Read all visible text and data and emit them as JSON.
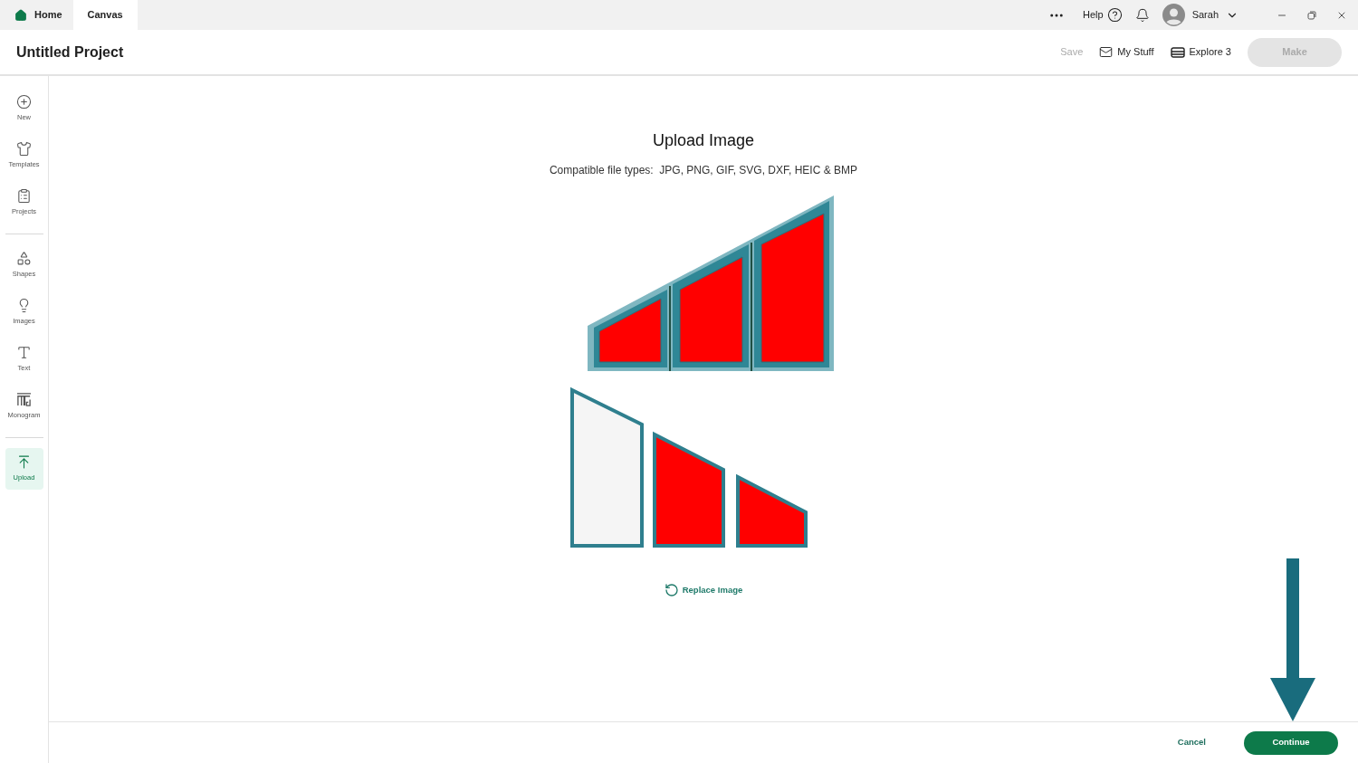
{
  "tabs": [
    {
      "label": "Home",
      "selected": false
    },
    {
      "label": "Canvas",
      "selected": true
    }
  ],
  "top_bar": {
    "help": "Help",
    "user": "Sarah"
  },
  "header": {
    "title": "Untitled Project",
    "save": {
      "label": "Save",
      "disabled": true
    },
    "my_stuff": "My Stuff",
    "machine": "Explore 3",
    "make": {
      "label": "Make",
      "disabled": true
    }
  },
  "sidebar": {
    "groups": [
      [
        {
          "label": "New",
          "kind": "new",
          "selected": false
        },
        {
          "label": "Templates",
          "kind": "templates",
          "selected": false
        },
        {
          "label": "Projects",
          "kind": "projects",
          "selected": false
        }
      ],
      [
        {
          "label": "Shapes",
          "kind": "shapes",
          "selected": false
        },
        {
          "label": "Images",
          "kind": "images",
          "selected": false
        },
        {
          "label": "Text",
          "kind": "text",
          "selected": false
        },
        {
          "label": "Monogram",
          "kind": "monogram",
          "selected": false
        }
      ],
      [
        {
          "label": "Upload",
          "kind": "upload",
          "selected": true
        }
      ]
    ]
  },
  "upload": {
    "title": "Upload Image",
    "subtitle": "Compatible file types:  JPG, PNG, GIF, SVG, DXF, HEIC & BMP",
    "replace": "Replace Image"
  },
  "footer": {
    "cancel": "Cancel",
    "continue": "Continue"
  }
}
